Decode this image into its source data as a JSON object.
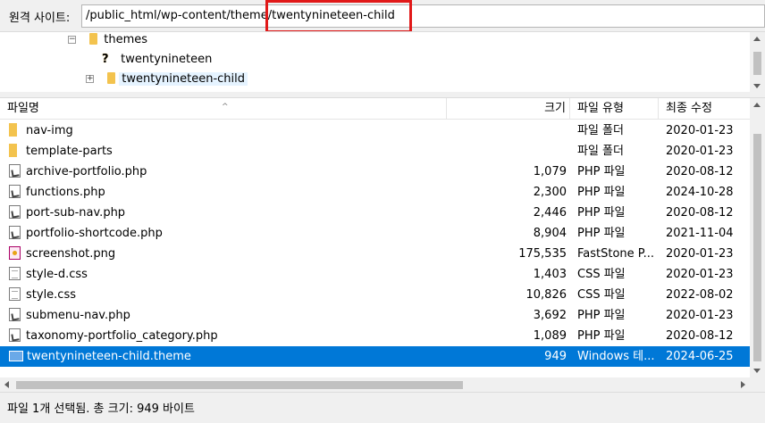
{
  "pathbar": {
    "label": "원격 사이트:",
    "path_prefix": "/public_html/wp-content/theme",
    "path_highlighted": "/twentynineteen-child"
  },
  "tree": {
    "items": [
      {
        "label": "themes",
        "icon": "folder-icon"
      },
      {
        "label": "twentynineteen",
        "icon": "question-icon"
      },
      {
        "label": "twentynineteen-child",
        "icon": "folder-icon"
      }
    ]
  },
  "columns": {
    "name": "파일명",
    "size": "크기",
    "type": "파일 유형",
    "date": "최종 수정"
  },
  "files": [
    {
      "name": "nav-img",
      "size": "",
      "type": "파일 폴더",
      "date": "2020-01-23",
      "icon": "folder"
    },
    {
      "name": "template-parts",
      "size": "",
      "type": "파일 폴더",
      "date": "2020-01-23",
      "icon": "folder"
    },
    {
      "name": "archive-portfolio.php",
      "size": "1,079",
      "type": "PHP 파일",
      "date": "2020-08-12",
      "icon": "php"
    },
    {
      "name": "functions.php",
      "size": "2,300",
      "type": "PHP 파일",
      "date": "2024-10-28",
      "icon": "php"
    },
    {
      "name": "port-sub-nav.php",
      "size": "2,446",
      "type": "PHP 파일",
      "date": "2020-08-12",
      "icon": "php"
    },
    {
      "name": "portfolio-shortcode.php",
      "size": "8,904",
      "type": "PHP 파일",
      "date": "2021-11-04",
      "icon": "php"
    },
    {
      "name": "screenshot.png",
      "size": "175,535",
      "type": "FastStone P...",
      "date": "2020-01-23",
      "icon": "png"
    },
    {
      "name": "style-d.css",
      "size": "1,403",
      "type": "CSS 파일",
      "date": "2020-01-23",
      "icon": "css"
    },
    {
      "name": "style.css",
      "size": "10,826",
      "type": "CSS 파일",
      "date": "2022-08-02",
      "icon": "css"
    },
    {
      "name": "submenu-nav.php",
      "size": "3,692",
      "type": "PHP 파일",
      "date": "2020-01-23",
      "icon": "php"
    },
    {
      "name": "taxonomy-portfolio_category.php",
      "size": "1,089",
      "type": "PHP 파일",
      "date": "2020-08-12",
      "icon": "php"
    },
    {
      "name": "twentynineteen-child.theme",
      "size": "949",
      "type": "Windows 테...",
      "date": "2024-06-25",
      "icon": "theme",
      "selected": true
    }
  ],
  "status": {
    "text": "파일 1개 선택됨. 총 크기: 949 바이트"
  },
  "colors": {
    "selection": "#0078d7",
    "highlight_box": "#e11919",
    "folder": "#f3c34e"
  }
}
